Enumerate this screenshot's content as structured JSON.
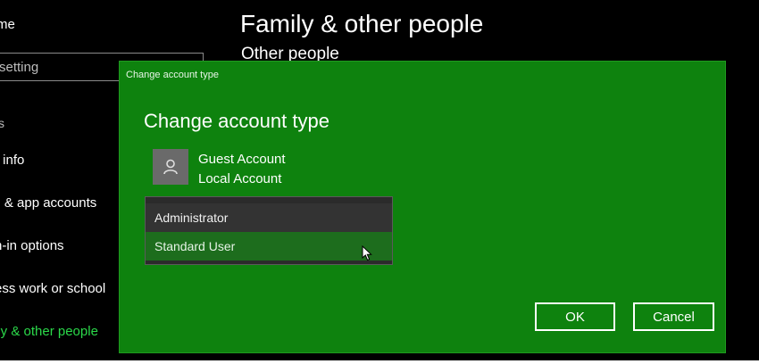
{
  "sidebar": {
    "home_label": "me",
    "search_placeholder": "setting",
    "section_label": "s",
    "items": [
      {
        "label": "r info"
      },
      {
        "label": "il & app accounts"
      },
      {
        "label": "n-in options"
      },
      {
        "label": "ess work or school"
      },
      {
        "label": "ily & other people",
        "active": true
      }
    ]
  },
  "page": {
    "title": "Family & other people",
    "subtitle": "Other people"
  },
  "dialog": {
    "window_title": "Change account type",
    "heading": "Change account type",
    "account": {
      "name": "Guest Account",
      "type": "Local Account",
      "avatar_icon": "user-icon"
    },
    "account_type_options": [
      "Administrator",
      "Standard User"
    ],
    "highlighted_option": "Standard User",
    "ok_label": "OK",
    "cancel_label": "Cancel"
  },
  "colors": {
    "dialog_background": "#0e820e",
    "active_nav": "#2bd94a",
    "page_background": "#000000"
  }
}
